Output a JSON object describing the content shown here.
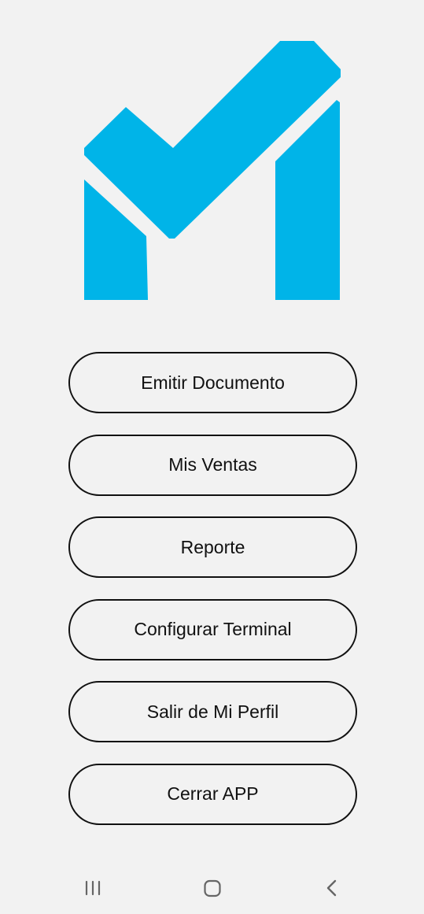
{
  "app": {
    "logo_icon": "m-checkmark-logo",
    "brand_color": "#00b4e8"
  },
  "menu": {
    "items": [
      {
        "label": "Emitir Documento"
      },
      {
        "label": "Mis Ventas"
      },
      {
        "label": "Reporte"
      },
      {
        "label": "Configurar Terminal"
      },
      {
        "label": "Salir de Mi Perfil"
      },
      {
        "label": "Cerrar APP"
      }
    ]
  },
  "navbar": {
    "recent_icon": "recent-apps-icon",
    "home_icon": "home-icon",
    "back_icon": "back-icon"
  }
}
